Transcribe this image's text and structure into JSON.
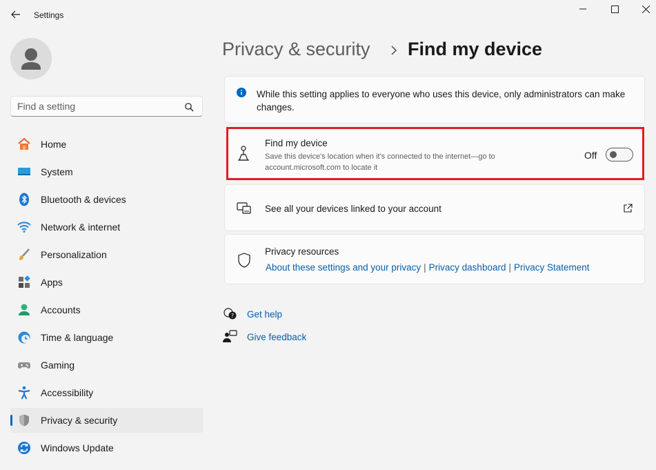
{
  "window": {
    "title": "Settings"
  },
  "search": {
    "placeholder": "Find a setting"
  },
  "sidebar": {
    "items": [
      {
        "label": "Home",
        "icon": "home-icon"
      },
      {
        "label": "System",
        "icon": "system-icon"
      },
      {
        "label": "Bluetooth & devices",
        "icon": "bluetooth-icon"
      },
      {
        "label": "Network & internet",
        "icon": "wifi-icon"
      },
      {
        "label": "Personalization",
        "icon": "brush-icon"
      },
      {
        "label": "Apps",
        "icon": "apps-icon"
      },
      {
        "label": "Accounts",
        "icon": "accounts-icon"
      },
      {
        "label": "Time & language",
        "icon": "clock-globe-icon"
      },
      {
        "label": "Gaming",
        "icon": "gamepad-icon"
      },
      {
        "label": "Accessibility",
        "icon": "accessibility-icon"
      },
      {
        "label": "Privacy & security",
        "icon": "shield-icon",
        "active": true
      },
      {
        "label": "Windows Update",
        "icon": "update-icon"
      }
    ]
  },
  "breadcrumb": {
    "parent": "Privacy & security",
    "current": "Find my device"
  },
  "info_banner": {
    "text": "While this setting applies to everyone who uses this device, only administrators can make changes."
  },
  "find_my_device": {
    "title": "Find my device",
    "description": "Save this device's location when it's connected to the internet—go to account.microsoft.com to locate it",
    "toggle_state": "Off",
    "enabled": false
  },
  "linked_devices": {
    "label": "See all your devices linked to your account"
  },
  "privacy_resources": {
    "title": "Privacy resources",
    "links": [
      "About these settings and your privacy",
      "Privacy dashboard",
      "Privacy Statement"
    ]
  },
  "help": {
    "get_help": "Get help",
    "give_feedback": "Give feedback"
  },
  "colors": {
    "accent": "#0067c0",
    "link": "#0a5ea8",
    "highlight_border": "#e01e26",
    "background": "#f3f3f3",
    "card": "#fbfbfb"
  }
}
